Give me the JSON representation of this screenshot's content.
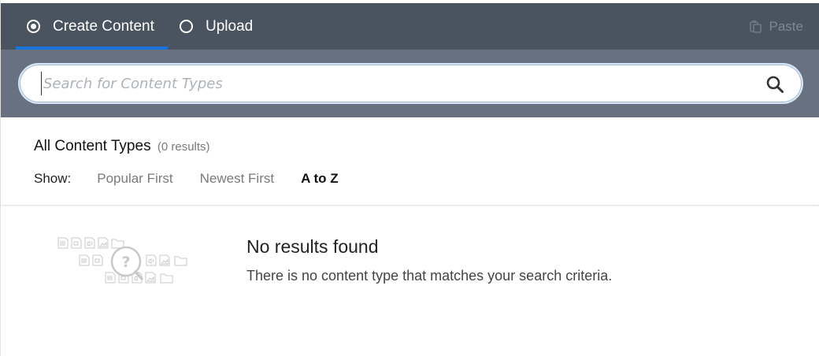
{
  "tabs": {
    "create_label": "Create Content",
    "upload_label": "Upload",
    "selected": "create"
  },
  "paste_label": "Paste",
  "search": {
    "placeholder": "Search for Content Types",
    "value": ""
  },
  "content_types": {
    "heading": "All Content Types",
    "count": "(0 results)"
  },
  "show": {
    "label": "Show:",
    "options": [
      "Popular First",
      "Newest First",
      "A to Z"
    ],
    "active": "A to Z"
  },
  "empty_state": {
    "title": "No results found",
    "message": "There is no content type that matches your search criteria."
  },
  "colors": {
    "tabbar_bg": "#4a5461",
    "search_band_bg": "#68717f",
    "tab_underline": "#1a73d9"
  },
  "icons": [
    "radio-selected-icon",
    "radio-unselected-icon",
    "paste-icon",
    "search-icon",
    "no-results-illustration"
  ]
}
